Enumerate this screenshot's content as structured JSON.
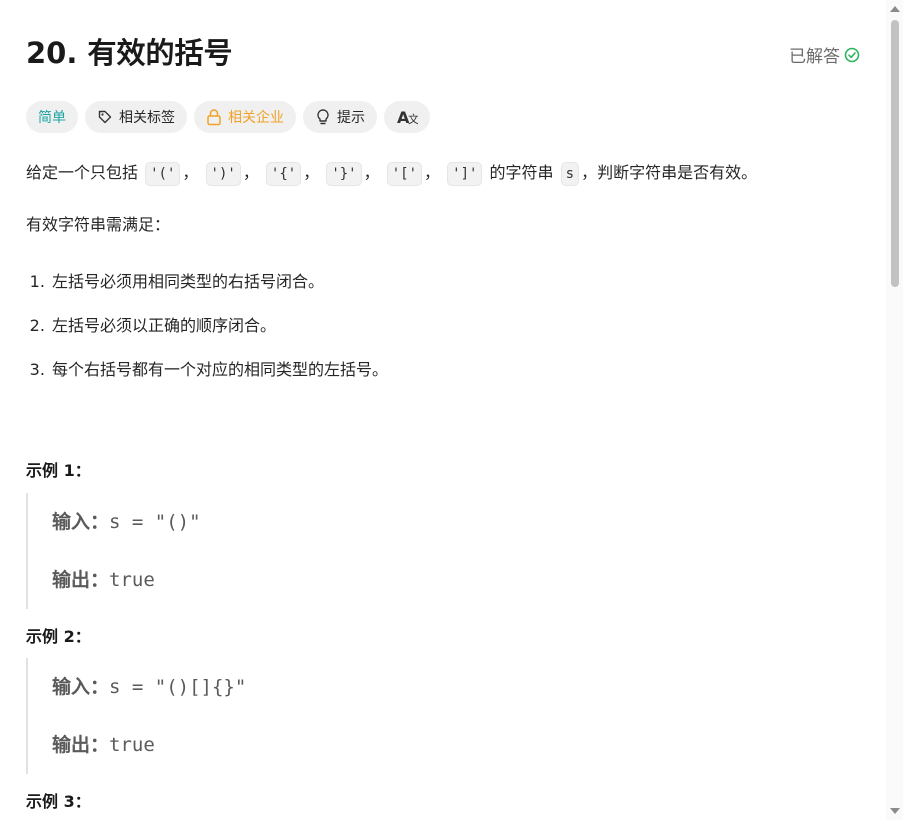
{
  "problem": {
    "title": "20. 有效的括号",
    "status": "已解答",
    "tags": {
      "difficulty": "简单",
      "topics": "相关标签",
      "companies": "相关企业",
      "hint": "提示"
    },
    "description": {
      "prefix": "给定一个只包括",
      "chars": [
        "'('",
        "')'",
        "'{'",
        "'}'",
        "'['",
        "']'"
      ],
      "separator": "，",
      "middle": "的字符串",
      "var": "s",
      "suffix": "，判断字符串是否有效。"
    },
    "rules_intro": "有效字符串需满足：",
    "rules": [
      "左括号必须用相同类型的右括号闭合。",
      "左括号必须以正确的顺序闭合。",
      "每个右括号都有一个对应的相同类型的左括号。"
    ],
    "examples": [
      {
        "title": "示例 1：",
        "input_label": "输入：",
        "input": "s = \"()\"",
        "output_label": "输出：",
        "output": "true"
      },
      {
        "title": "示例 2：",
        "input_label": "输入：",
        "input": "s = \"()[]{}\"",
        "output_label": "输出：",
        "output": "true"
      },
      {
        "title": "示例 3："
      }
    ]
  },
  "colors": {
    "easy": "#1fa4a4",
    "company": "#f0a227",
    "solved_check": "#2db55d"
  }
}
